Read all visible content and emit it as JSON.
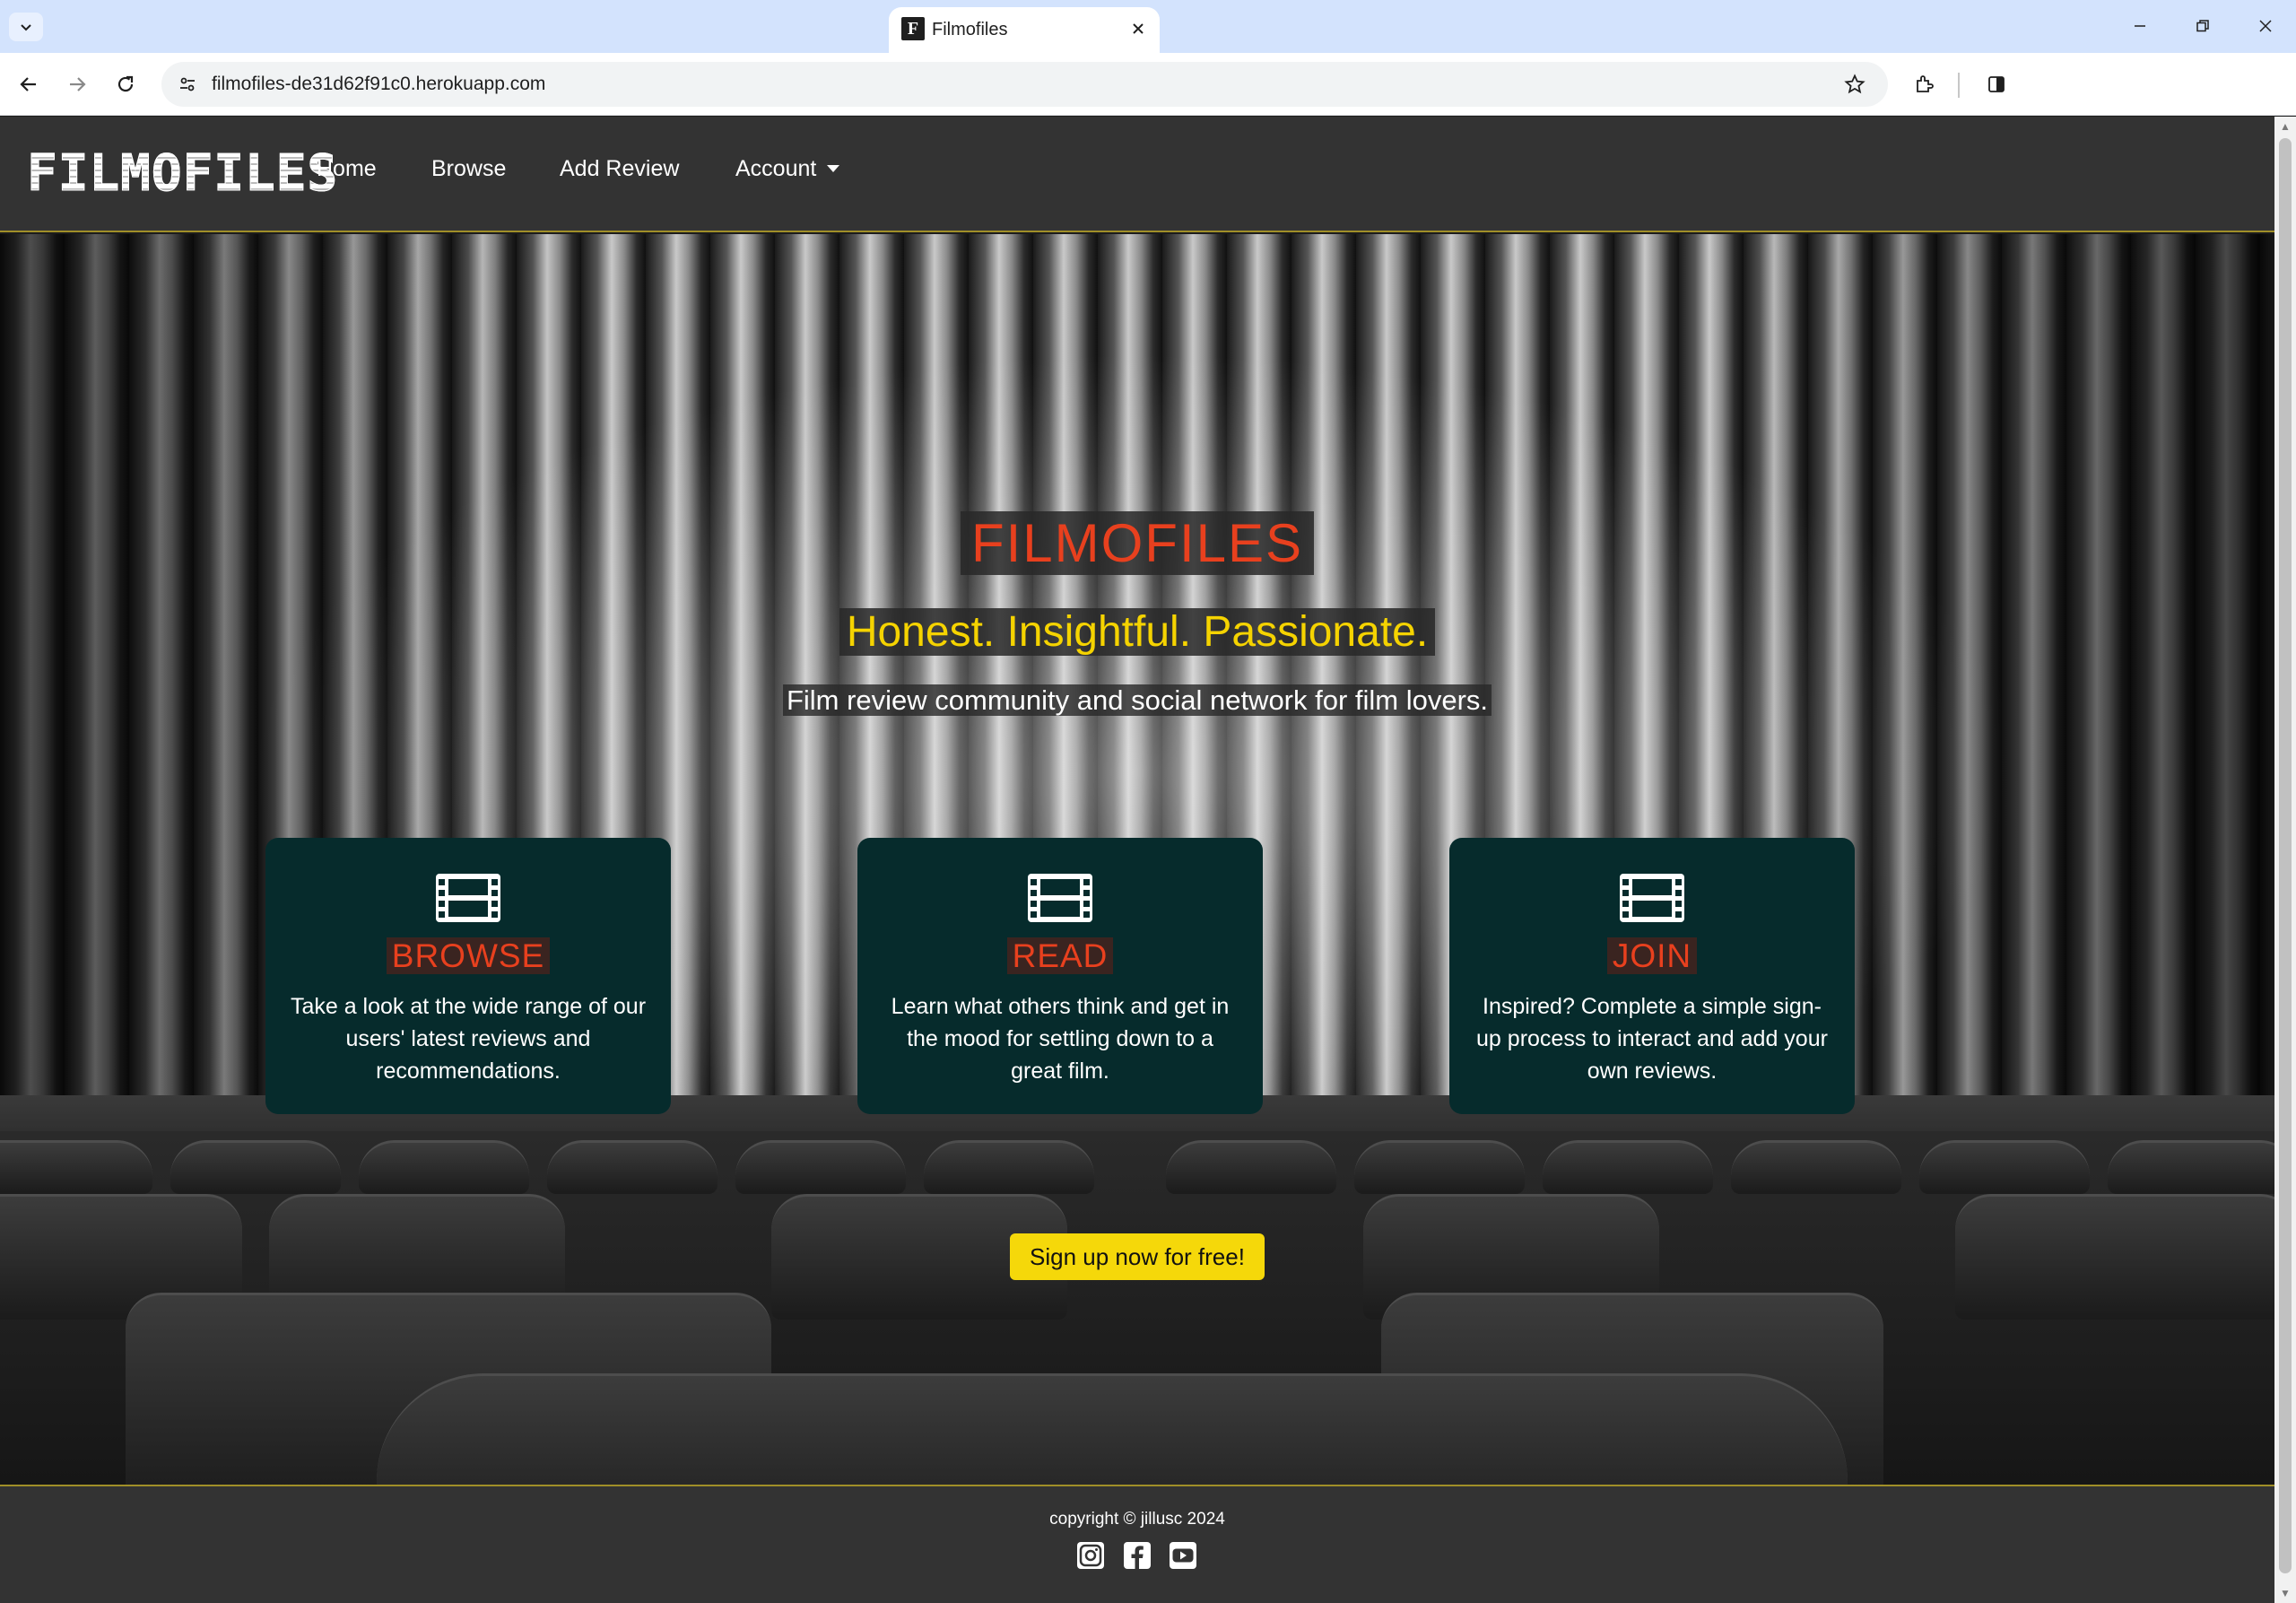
{
  "browser": {
    "tab_title": "Filmofiles",
    "tab_favicon_letter": "F",
    "url": "filmofiles-de31d62f91c0.herokuapp.com"
  },
  "navbar": {
    "brand": "FILMOFILES",
    "links": {
      "home": "Home",
      "browse": "Browse",
      "add_review": "Add Review",
      "account": "Account"
    }
  },
  "hero": {
    "title": "FILMOFILES",
    "tagline": "Honest. Insightful. Passionate.",
    "subtitle": "Film review community and social network for film lovers.",
    "cards": [
      {
        "icon": "film-icon",
        "title": "BROWSE",
        "text": "Take a look at the wide range of our users' latest reviews and recommendations."
      },
      {
        "icon": "film-icon",
        "title": "READ",
        "text": "Learn what others think and get in the mood for settling down to a great film."
      },
      {
        "icon": "film-icon",
        "title": "JOIN",
        "text": "Inspired? Complete a simple sign-up process to interact and add your own reviews."
      }
    ],
    "cta": "Sign up now for free!"
  },
  "footer": {
    "copyright": "copyright © jillusc 2024",
    "social": [
      "instagram-icon",
      "facebook-icon",
      "youtube-icon"
    ]
  },
  "colors": {
    "navbar_bg": "#333333",
    "accent_red": "#e8401e",
    "accent_yellow": "#f5d300",
    "card_bg": "#062b2c",
    "border_gold": "#a08f28"
  }
}
